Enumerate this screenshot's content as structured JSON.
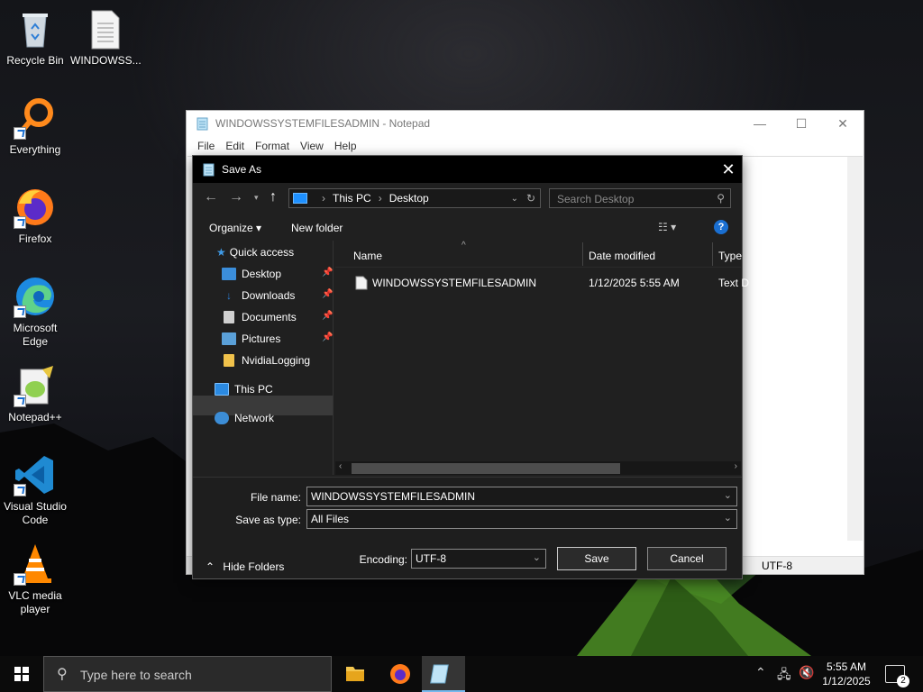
{
  "desktop": {
    "icons": [
      {
        "name": "recycle-bin",
        "label": "Recycle Bin"
      },
      {
        "name": "windowss-file",
        "label": "WINDOWSS..."
      },
      {
        "name": "everything",
        "label": "Everything"
      },
      {
        "name": "firefox",
        "label": "Firefox"
      },
      {
        "name": "microsoft-edge",
        "label": "Microsoft Edge"
      },
      {
        "name": "notepad-plus-plus",
        "label": "Notepad++"
      },
      {
        "name": "visual-studio-code",
        "label": "Visual Studio Code"
      },
      {
        "name": "vlc",
        "label": "VLC media player"
      }
    ]
  },
  "notepad": {
    "title": "WINDOWSSYSTEMFILESADMIN - Notepad",
    "menu": [
      "File",
      "Edit",
      "Format",
      "View",
      "Help"
    ],
    "controls": {
      "minimize": "—",
      "maximize": "☐",
      "close": "✕"
    },
    "status_encoding": "UTF-8"
  },
  "dialog": {
    "title": "Save As",
    "close": "✕",
    "address": {
      "segments": [
        "This PC",
        "Desktop"
      ]
    },
    "search_placeholder": "Search Desktop",
    "toolbar": {
      "organize": "Organize ▾",
      "new_folder": "New folder"
    },
    "sidebar": {
      "quick_access": "Quick access",
      "items": [
        {
          "label": "Desktop",
          "color": "#3b8edb",
          "pinned": true
        },
        {
          "label": "Downloads",
          "color": "#2d7fd4",
          "pinned": true
        },
        {
          "label": "Documents",
          "color": "#d0d0d0",
          "pinned": true
        },
        {
          "label": "Pictures",
          "color": "#5aa0d8",
          "pinned": true
        },
        {
          "label": "NvidiaLogging",
          "color": "#f1c24b",
          "pinned": false
        }
      ],
      "this_pc": "This PC",
      "network": "Network"
    },
    "columns": {
      "name": "Name",
      "date": "Date modified",
      "type": "Type"
    },
    "files": [
      {
        "name": "WINDOWSSYSTEMFILESADMIN",
        "date": "1/12/2025 5:55 AM",
        "type": "Text D"
      }
    ],
    "form": {
      "file_name_label": "File name:",
      "file_name_value": "WINDOWSSYSTEMFILESADMIN",
      "save_type_label": "Save as type:",
      "save_type_value": "All Files",
      "encoding_label": "Encoding:",
      "encoding_value": "UTF-8",
      "save": "Save",
      "cancel": "Cancel",
      "hide_folders": "Hide Folders"
    }
  },
  "taskbar": {
    "search_placeholder": "Type here to search",
    "clock_time": "5:55 AM",
    "clock_date": "1/12/2025",
    "notification_count": "2"
  },
  "colors": {
    "accent": "#1a6fd1",
    "dialog_bg": "#202020",
    "taskbar_bg": "#0b0b0b"
  }
}
